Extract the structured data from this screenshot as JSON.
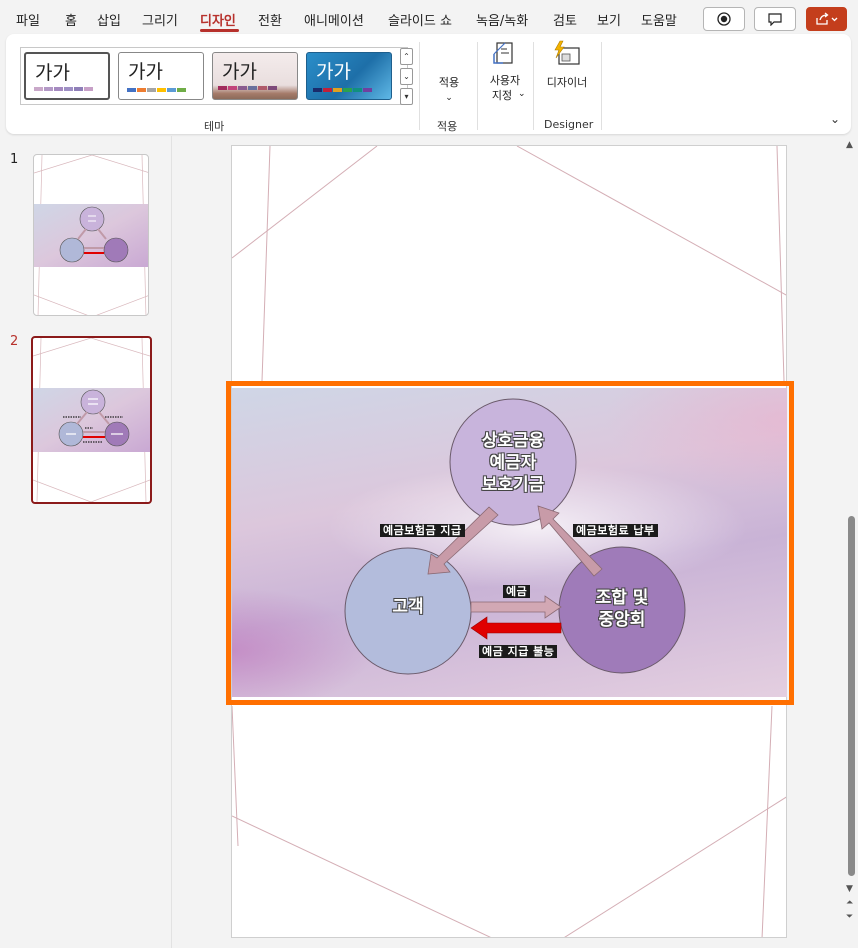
{
  "menu": {
    "items": [
      "파일",
      "홈",
      "삽입",
      "그리기",
      "디자인",
      "전환",
      "애니메이션",
      "슬라이드 쇼",
      "녹음/녹화",
      "검토",
      "보기",
      "도움말"
    ],
    "active": "디자인"
  },
  "ribbon": {
    "themes": [
      "가가",
      "가가",
      "가가",
      "가가"
    ],
    "group_theme_label": "테마",
    "apply": {
      "label": "적용",
      "group_label": "적용"
    },
    "custom": {
      "line1": "사용자",
      "line2": "지정"
    },
    "designer": {
      "label": "디자이너",
      "group_label": "Designer"
    }
  },
  "thumbnails": [
    {
      "number": "1",
      "selected": false
    },
    {
      "number": "2",
      "selected": true
    }
  ],
  "slide": {
    "top_circle": [
      "상호금융",
      "예금자",
      "보호기금"
    ],
    "left_circle": "고객",
    "right_circle": [
      "조합 및",
      "중앙회"
    ],
    "label_payout": "예금보험금 지급",
    "label_premium": "예금보험료 납부",
    "label_deposit": "예금",
    "label_repay": "예금 지급 불능"
  },
  "colors": {
    "accent": "#b7312c",
    "selection": "#ff6f00",
    "share_button": "#c43e1c"
  }
}
